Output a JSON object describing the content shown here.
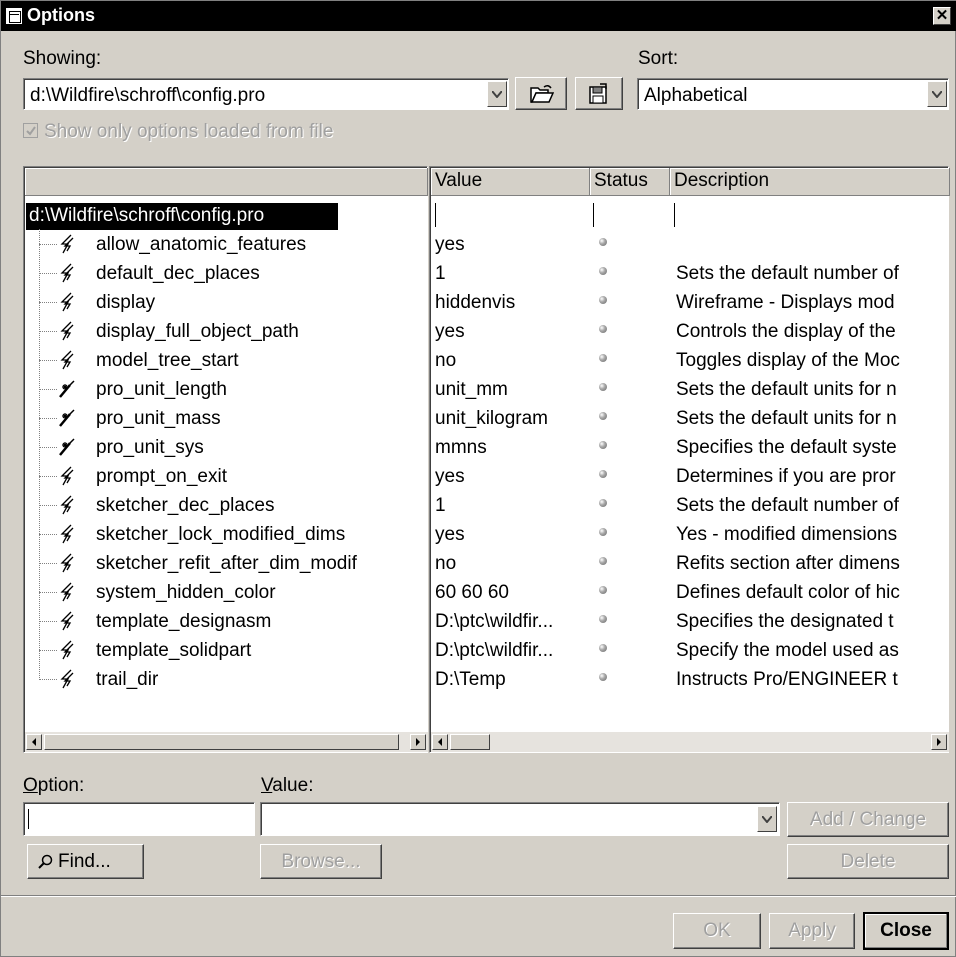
{
  "window": {
    "title": "Options"
  },
  "showing": {
    "label": "Showing:",
    "value": "d:\\Wildfire\\schroff\\config.pro"
  },
  "sort": {
    "label": "Sort:",
    "value": "Alphabetical"
  },
  "show_only_checkbox": {
    "label": "Show only options loaded from file",
    "checked": true
  },
  "table": {
    "headers": {
      "name": "",
      "value": "Value",
      "status": "Status",
      "description": "Description"
    },
    "root": "d:\\Wildfire\\schroff\\config.pro",
    "rows": [
      {
        "name": "allow_anatomic_features",
        "value": "yes",
        "icon": "lightning-icon",
        "description": ""
      },
      {
        "name": "default_dec_places",
        "value": "1",
        "icon": "lightning-icon",
        "description": "Sets the default number of"
      },
      {
        "name": "display",
        "value": "hiddenvis",
        "icon": "lightning-icon",
        "description": "Wireframe - Displays mod"
      },
      {
        "name": "display_full_object_path",
        "value": "yes",
        "icon": "lightning-icon",
        "description": "Controls the display of the"
      },
      {
        "name": "model_tree_start",
        "value": "no",
        "icon": "lightning-icon",
        "description": "Toggles display of the Moc"
      },
      {
        "name": "pro_unit_length",
        "value": "unit_mm",
        "icon": "wand-icon",
        "description": "Sets the default units for n"
      },
      {
        "name": "pro_unit_mass",
        "value": "unit_kilogram",
        "icon": "wand-icon",
        "description": "Sets the default units for n"
      },
      {
        "name": "pro_unit_sys",
        "value": "mmns",
        "icon": "wand-icon",
        "description": "Specifies the default syste"
      },
      {
        "name": "prompt_on_exit",
        "value": "yes",
        "icon": "lightning-icon",
        "description": "Determines if you are pror"
      },
      {
        "name": "sketcher_dec_places",
        "value": "1",
        "icon": "lightning-icon",
        "description": "Sets the default number of"
      },
      {
        "name": "sketcher_lock_modified_dims",
        "value": "yes",
        "icon": "lightning-icon",
        "description": "Yes - modified dimensions"
      },
      {
        "name": "sketcher_refit_after_dim_modif",
        "value": "no",
        "icon": "lightning-icon",
        "description": "Refits section after dimens"
      },
      {
        "name": "system_hidden_color",
        "value": "60 60 60",
        "icon": "lightning-icon",
        "description": "Defines default color of hic"
      },
      {
        "name": "template_designasm",
        "value": "D:\\ptc\\wildfir...",
        "icon": "lightning-icon",
        "description": "Specifies the designated t"
      },
      {
        "name": "template_solidpart",
        "value": "D:\\ptc\\wildfir...",
        "icon": "lightning-icon",
        "description": "Specify the model used as"
      },
      {
        "name": "trail_dir",
        "value": "D:\\Temp",
        "icon": "lightning-icon",
        "description": "Instructs Pro/ENGINEER t"
      }
    ]
  },
  "option_label": "Option:",
  "value_label": "Value:",
  "option_input": "",
  "value_input": "",
  "buttons": {
    "add_change": "Add / Change",
    "find": "Find...",
    "browse": "Browse...",
    "delete": "Delete",
    "ok": "OK",
    "apply": "Apply",
    "close": "Close"
  }
}
